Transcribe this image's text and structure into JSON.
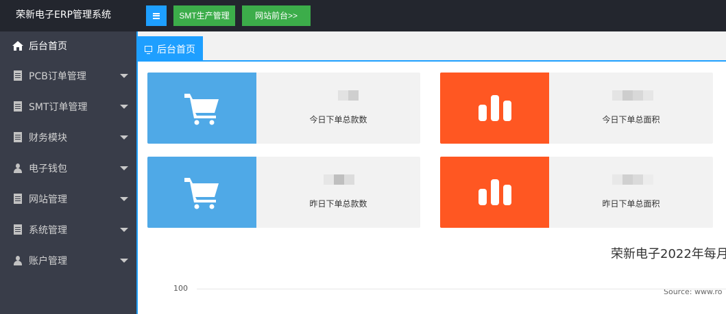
{
  "app": {
    "title": "荣新电子ERP管理系统"
  },
  "topbar": {
    "smt_button": "SMT生产管理",
    "site_button": "网站前台>>"
  },
  "sidebar": {
    "items": [
      {
        "label": "后台首页",
        "icon": "home-icon",
        "active": true
      },
      {
        "label": "PCB订单管理",
        "icon": "document-icon"
      },
      {
        "label": "SMT订单管理",
        "icon": "document-icon"
      },
      {
        "label": "财务模块",
        "icon": "document-icon"
      },
      {
        "label": "电子钱包",
        "icon": "user-icon"
      },
      {
        "label": "网站管理",
        "icon": "document-icon"
      },
      {
        "label": "系统管理",
        "icon": "document-icon"
      },
      {
        "label": "账户管理",
        "icon": "user-icon"
      }
    ]
  },
  "tabs": [
    {
      "label": "后台首页",
      "active": true
    }
  ],
  "stats": [
    {
      "label": "今日下单总款数",
      "icon": "cart-icon",
      "color": "#4fa9e7"
    },
    {
      "label": "今日下单总面积",
      "icon": "bar-chart-icon",
      "color": "#ff5722"
    },
    {
      "label": "昨日下单总款数",
      "icon": "cart-icon",
      "color": "#4fa9e7"
    },
    {
      "label": "昨日下单总面积",
      "icon": "bar-chart-icon",
      "color": "#ff5722"
    }
  ],
  "chart": {
    "title": "荣新电子2022年每月",
    "source": "Source: www.ro",
    "y_tick": "100"
  },
  "colors": {
    "accent": "#1e9fff",
    "green": "#3cad4a",
    "sidebar_bg": "#393d49",
    "topbar_bg": "#23262e"
  }
}
